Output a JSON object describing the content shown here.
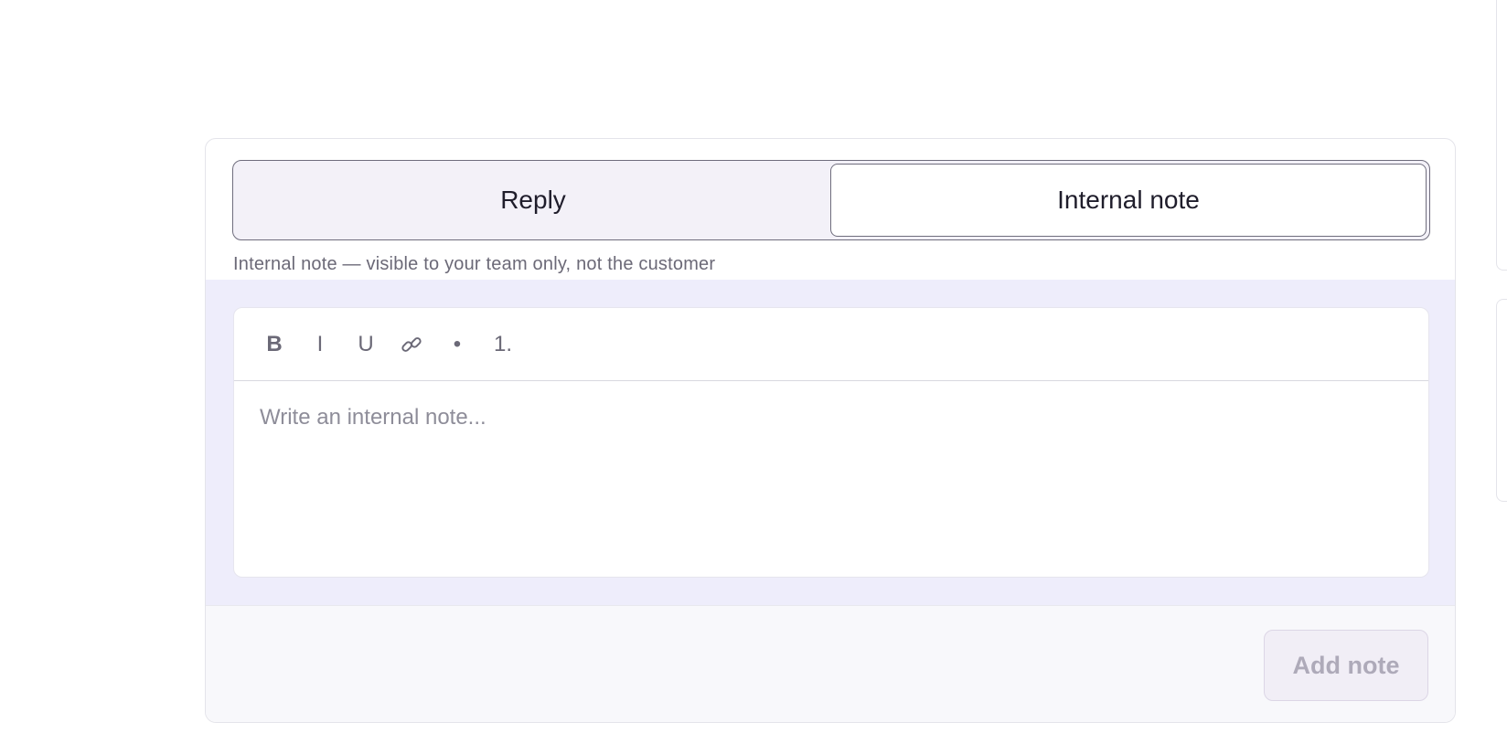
{
  "composer": {
    "tabs": [
      {
        "label": "Reply",
        "active": false
      },
      {
        "label": "Internal note",
        "active": true
      }
    ],
    "hint": "Internal note — visible to your team only, not the customer",
    "toolbar": {
      "bold": "B",
      "italic": "I",
      "underline": "U",
      "link_icon": "link-icon",
      "bullet": "•",
      "numbered": "1."
    },
    "editor": {
      "placeholder": "Write an internal note..."
    },
    "submit_label": "Add note"
  },
  "colors": {
    "editor_background": "#eeedfb",
    "toggle_background": "#f3f1f8",
    "hint_text": "#6b6977",
    "disabled_button_text": "#aeaab9"
  }
}
